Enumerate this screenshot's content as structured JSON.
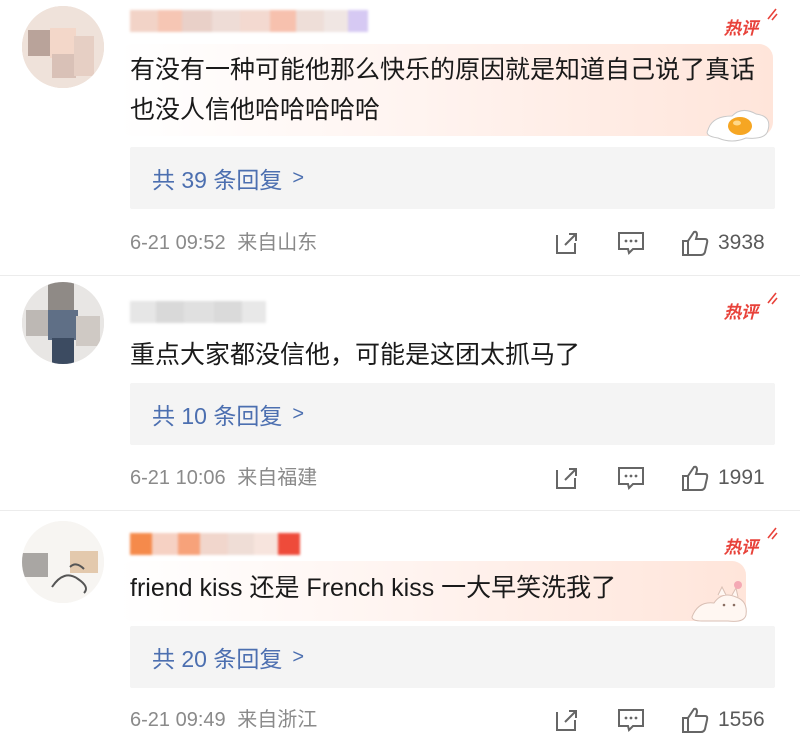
{
  "comments": [
    {
      "hot_label": "热评",
      "text": "有没有一种可能他那么快乐的原因就是知道自己说了真话也没人信他哈哈哈哈哈",
      "reply_label": "共 39 条回复",
      "chevron": ">",
      "time": "6-21 09:52",
      "location": "来自山东",
      "likes": "3938"
    },
    {
      "hot_label": "热评",
      "text": "重点大家都没信他，可能是这团太抓马了",
      "reply_label": "共 10 条回复",
      "chevron": ">",
      "time": "6-21 10:06",
      "location": "来自福建",
      "likes": "1991"
    },
    {
      "hot_label": "热评",
      "text": "friend kiss 还是 French kiss 一大早笑洗我了",
      "reply_label": "共 20 条回复",
      "chevron": ">",
      "time": "6-21 09:49",
      "location": "来自浙江",
      "likes": "1556"
    }
  ],
  "colors": {
    "hot_badge": "#e8423a",
    "reply_link": "#4c6fb0",
    "meta_text": "#8a8a8a",
    "reply_bg": "#f4f4f4"
  },
  "icons": [
    "share-icon",
    "comment-icon",
    "like-icon",
    "hot-badge-icon",
    "fried-egg-sticker-icon",
    "cat-sticker-icon"
  ]
}
